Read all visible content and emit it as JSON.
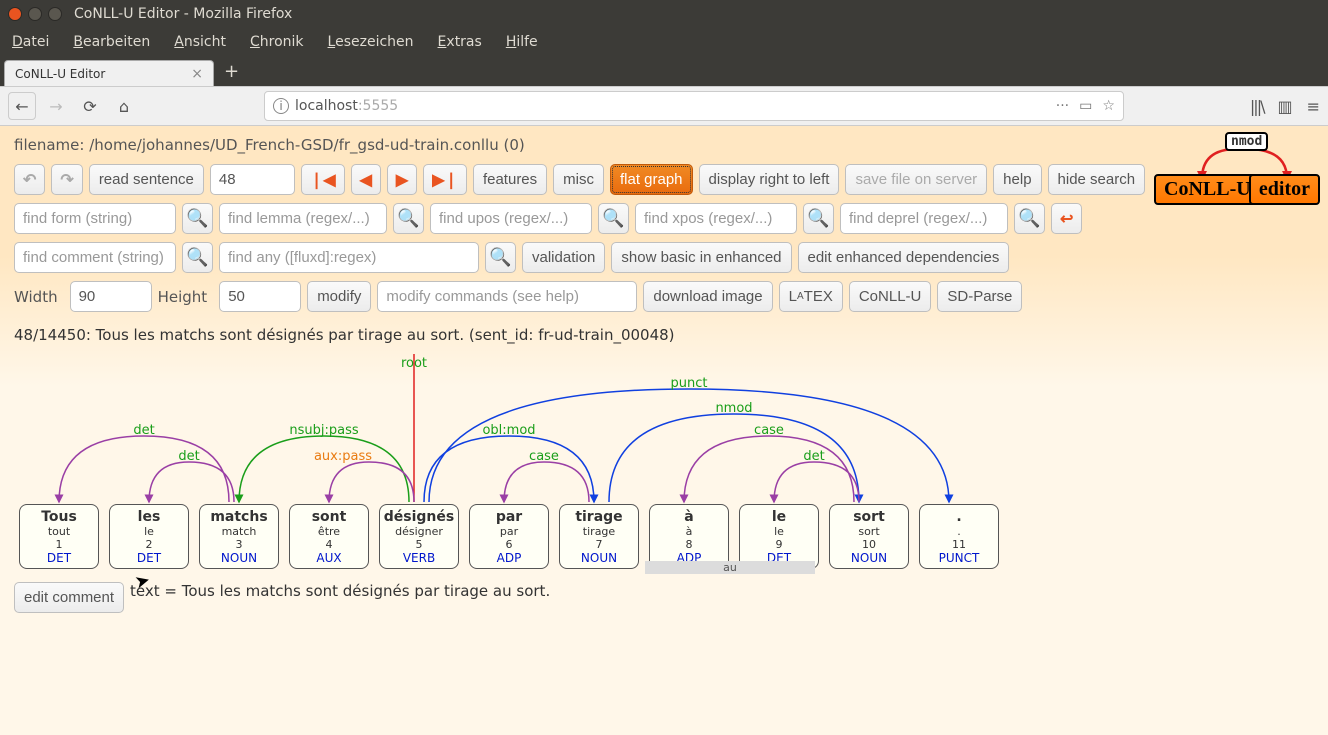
{
  "window": {
    "title": "CoNLL-U Editor - Mozilla Firefox"
  },
  "menubar": [
    "Datei",
    "Bearbeiten",
    "Ansicht",
    "Chronik",
    "Lesezeichen",
    "Extras",
    "Hilfe"
  ],
  "tab": {
    "title": "CoNLL-U Editor"
  },
  "url": {
    "host": "localhost",
    "port": ":5555"
  },
  "filename": "filename: /home/johannes/UD_French-GSD/fr_gsd-ud-train.conllu (0)",
  "logo": {
    "tag": "nmod",
    "left": "CoNLL-U",
    "right": "editor"
  },
  "toolbar1": {
    "read_sentence": "read sentence",
    "sentence_no": "48",
    "features": "features",
    "misc": "misc",
    "flat_graph": "flat graph",
    "rtl": "display right to left",
    "save": "save file on server",
    "help": "help",
    "hide_search": "hide search"
  },
  "search": {
    "form_ph": "find form (string)",
    "lemma_ph": "find lemma (regex/...)",
    "upos_ph": "find upos (regex/...)",
    "xpos_ph": "find xpos (regex/...)",
    "deprel_ph": "find deprel (regex/...)",
    "comment_ph": "find comment (string)",
    "any_ph": "find any ([fluxd]:regex)",
    "validation": "validation",
    "show_basic": "show basic in enhanced",
    "edit_enhanced": "edit enhanced dependencies"
  },
  "dims": {
    "width_label": "Width",
    "width": "90",
    "height_label": "Height",
    "height": "50",
    "modify": "modify",
    "modify_ph": "modify commands (see help)",
    "download": "download image",
    "latex": "LATEX",
    "conllu_btn": "CoNLL-U",
    "sdparse": "SD-Parse"
  },
  "sentence_line": "48/14450: Tous les matchs sont désignés par tirage au sort. (sent_id: fr-ud-train_00048)",
  "tokens": [
    {
      "form": "Tous",
      "lemma": "tout",
      "idx": "1",
      "upos": "DET"
    },
    {
      "form": "les",
      "lemma": "le",
      "idx": "2",
      "upos": "DET"
    },
    {
      "form": "matchs",
      "lemma": "match",
      "idx": "3",
      "upos": "NOUN"
    },
    {
      "form": "sont",
      "lemma": "être",
      "idx": "4",
      "upos": "AUX"
    },
    {
      "form": "désignés",
      "lemma": "désigner",
      "idx": "5",
      "upos": "VERB"
    },
    {
      "form": "par",
      "lemma": "par",
      "idx": "6",
      "upos": "ADP"
    },
    {
      "form": "tirage",
      "lemma": "tirage",
      "idx": "7",
      "upos": "NOUN"
    },
    {
      "form": "à",
      "lemma": "à",
      "idx": "8",
      "upos": "ADP"
    },
    {
      "form": "le",
      "lemma": "le",
      "idx": "9",
      "upos": "DET"
    },
    {
      "form": "sort",
      "lemma": "sort",
      "idx": "10",
      "upos": "NOUN"
    },
    {
      "form": ".",
      "lemma": ".",
      "idx": "11",
      "upos": "PUNCT"
    }
  ],
  "mwt": {
    "label": "au"
  },
  "deps": {
    "root": "root",
    "punct": "punct",
    "nmod": "nmod",
    "oblmod": "obl:mod",
    "case1": "case",
    "case2": "case",
    "nsubjpass": "nsubj:pass",
    "auxpass": "aux:pass",
    "det1": "det",
    "det2": "det",
    "det3": "det"
  },
  "text_row": {
    "btn": "edit comment",
    "text": "text = Tous les matchs sont désignés par tirage au sort."
  }
}
